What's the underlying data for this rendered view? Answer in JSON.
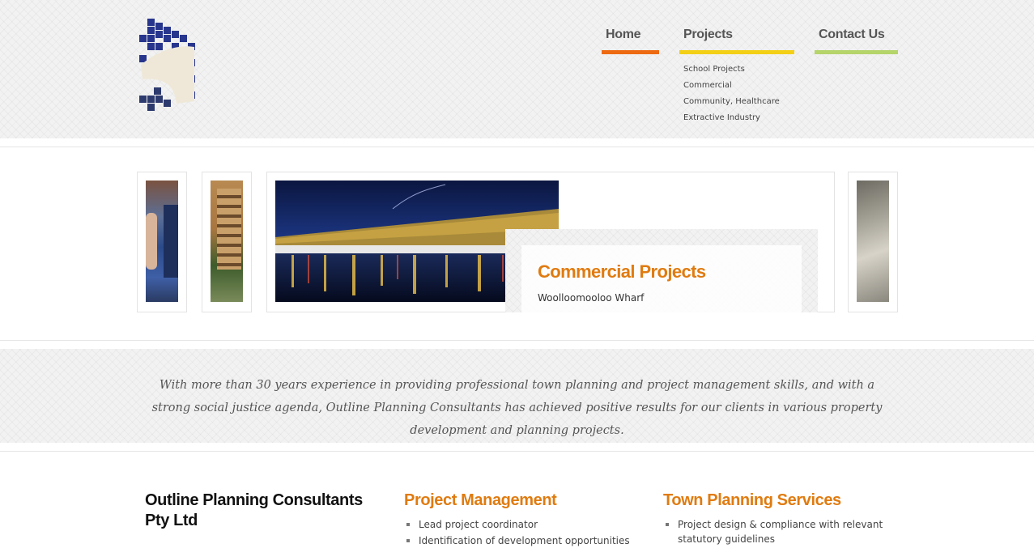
{
  "nav": {
    "items": [
      {
        "label": "Home",
        "color": "#ee6a12"
      },
      {
        "label": "Projects",
        "color": "#f3cf15"
      },
      {
        "label": "Contact Us",
        "color": "#b5d46a"
      }
    ],
    "projects_submenu": [
      "School Projects",
      "Commercial",
      "Community, Healthcare",
      "Extractive Industry"
    ]
  },
  "slider": {
    "title": "Commercial Projects",
    "subtitle": "Woolloomooloo Wharf"
  },
  "intro": {
    "text": "With more than 30 years experience in providing professional town planning and project management skills, and with a strong social justice agenda, Outline Planning Consultants has achieved positive results for our clients in various property development and planning projects."
  },
  "columns": [
    {
      "title": "Outline Planning Consultants Pty Ltd",
      "items": []
    },
    {
      "title": "Project Management",
      "items": [
        "Lead project coordinator",
        "Identification of development opportunities"
      ]
    },
    {
      "title": "Town Planning Services",
      "items": [
        "Project design & compliance with relevant statutory guidelines"
      ]
    }
  ],
  "colors": {
    "accent_orange": "#e07b10",
    "heading_dark": "#111111"
  }
}
